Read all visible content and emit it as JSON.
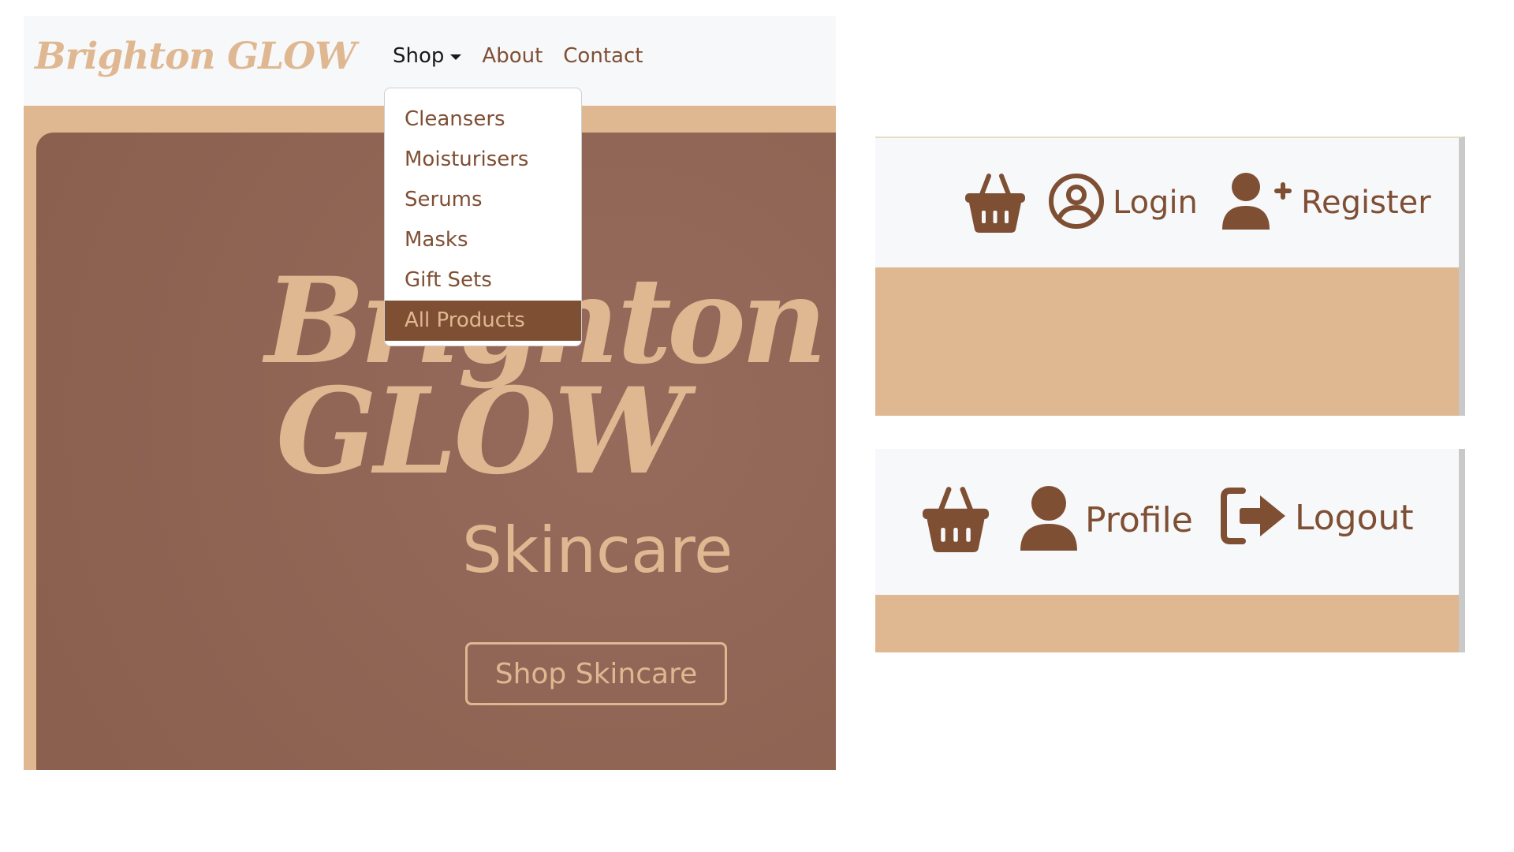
{
  "brand": "Brighton GLOW",
  "nav": {
    "shop": "Shop",
    "about": "About",
    "contact": "Contact"
  },
  "dropdown": {
    "items": [
      "Cleansers",
      "Moisturisers",
      "Serums",
      "Masks",
      "Gift Sets",
      "All Products"
    ],
    "active_item": "All Products"
  },
  "hero": {
    "title_line1": "Brighton",
    "title_line2": "GLOW",
    "subtitle": "Skincare",
    "cta": "Shop Skincare"
  },
  "panel_logged_out": {
    "basket_icon": "basket-icon",
    "login_label": "Login",
    "login_icon": "user-circle-icon",
    "register_label": "Register",
    "register_icon": "user-plus-icon"
  },
  "panel_logged_in": {
    "basket_icon": "basket-icon",
    "profile_label": "Profile",
    "profile_icon": "user-icon",
    "logout_label": "Logout",
    "logout_icon": "sign-out-icon"
  },
  "colors": {
    "brand_tan": "#dfb892",
    "brand_brown": "#7f4f34",
    "hero_bg": "#93685a",
    "navbar_bg": "#f7f8fa"
  }
}
